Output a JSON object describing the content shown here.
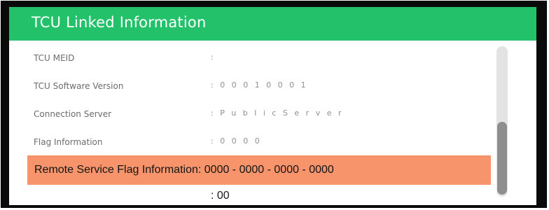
{
  "header": {
    "title": "TCU Linked Information"
  },
  "rows": [
    {
      "label": "TCU MEID",
      "value": ":"
    },
    {
      "label": "TCU Software Version",
      "value": ": 0 0 0 1 0 0 0 1"
    },
    {
      "label": "Connection Server",
      "value": ": P u b l i c   S e r v e r"
    },
    {
      "label": "Flag Information",
      "value": ": 0 0 0 0"
    }
  ],
  "highlight": {
    "text": "Remote Service Flag Information: 0000 - 0000 - 0000 - 0000"
  },
  "extra": {
    "value": ": 00"
  },
  "colors": {
    "header": "#23c16a",
    "highlight": "#f7946c",
    "background": "#ffffff"
  },
  "scrollbar": {
    "position": 0.72
  }
}
